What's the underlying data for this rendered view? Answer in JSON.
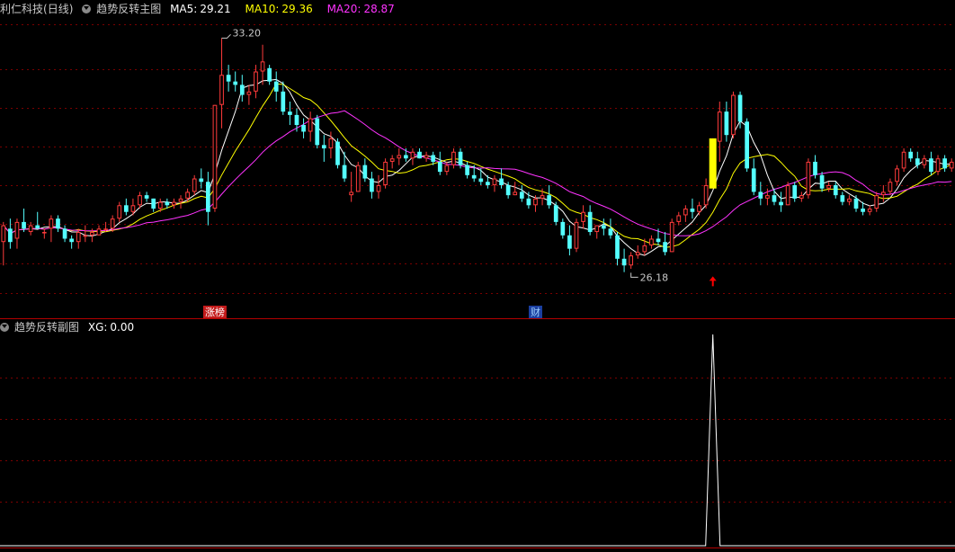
{
  "main_panel": {
    "stock_name": "利仁科技",
    "period": "(日线)",
    "indicator_name": "趋势反转主图",
    "ma5_label": "MA5:",
    "ma5_value": "29.21",
    "ma10_label": "MA10:",
    "ma10_value": "29.36",
    "ma20_label": "MA20:",
    "ma20_value": "28.87",
    "high_label": "33.20",
    "low_label": "26.18",
    "event_tag_1": "涨榜",
    "event_tag_2": "财"
  },
  "sub_panel": {
    "indicator_name": "趋势反转副图",
    "xg_label": "XG:",
    "xg_value": "0.00"
  },
  "colors": {
    "background": "#000000",
    "grid": "#7a0000",
    "up_candle": "#ff3b3b",
    "down_candle": "#54ffff",
    "ma5": "#ffffff",
    "ma10": "#ffff00",
    "ma20": "#ff33ff",
    "signal_bar": "#ffff00",
    "signal_arrow": "#ff0000",
    "xg_line": "#ffffff"
  },
  "chart_data": [
    {
      "type": "candlestick",
      "title": "趋势反转主图",
      "ylim": [
        25.6,
        33.8
      ],
      "candles": [
        [
          27.1,
          27.7,
          26.4,
          27.6
        ],
        [
          27.5,
          27.8,
          26.9,
          27.1
        ],
        [
          27.2,
          27.8,
          26.9,
          27.7
        ],
        [
          27.7,
          28.1,
          27.4,
          27.5
        ],
        [
          27.4,
          27.7,
          27.3,
          27.6
        ],
        [
          27.6,
          28.0,
          27.5,
          27.5
        ],
        [
          27.4,
          27.5,
          27.2,
          27.4
        ],
        [
          27.5,
          27.9,
          27.1,
          27.8
        ],
        [
          27.8,
          27.9,
          27.4,
          27.5
        ],
        [
          27.5,
          27.6,
          27.1,
          27.2
        ],
        [
          27.2,
          27.3,
          26.9,
          27.1
        ],
        [
          27.1,
          27.5,
          26.9,
          27.4
        ],
        [
          27.3,
          27.6,
          27.1,
          27.3
        ],
        [
          27.3,
          27.5,
          27.1,
          27.4
        ],
        [
          27.3,
          27.6,
          27.3,
          27.5
        ],
        [
          27.5,
          27.7,
          27.4,
          27.5
        ],
        [
          27.5,
          27.9,
          27.4,
          27.8
        ],
        [
          27.8,
          28.3,
          27.7,
          28.2
        ],
        [
          28.2,
          28.4,
          27.9,
          28.0
        ],
        [
          28.0,
          28.4,
          27.9,
          28.2
        ],
        [
          28.2,
          28.6,
          28.1,
          28.5
        ],
        [
          28.5,
          28.6,
          28.3,
          28.4
        ],
        [
          28.4,
          28.4,
          28.0,
          28.1
        ],
        [
          28.1,
          28.4,
          28.0,
          28.3
        ],
        [
          28.3,
          28.4,
          28.1,
          28.2
        ],
        [
          28.2,
          28.4,
          28.1,
          28.3
        ],
        [
          28.3,
          28.5,
          28.1,
          28.4
        ],
        [
          28.4,
          28.7,
          28.3,
          28.6
        ],
        [
          28.6,
          29.1,
          28.5,
          29.0
        ],
        [
          29.0,
          29.3,
          28.7,
          28.9
        ],
        [
          28.9,
          29.2,
          27.6,
          28.0
        ],
        [
          28.1,
          31.2,
          28.0,
          31.2
        ],
        [
          31.2,
          33.2,
          30.5,
          32.1
        ],
        [
          32.1,
          32.4,
          31.6,
          31.9
        ],
        [
          31.9,
          32.2,
          31.6,
          31.8
        ],
        [
          31.8,
          32.1,
          31.3,
          31.5
        ],
        [
          31.5,
          31.8,
          31.2,
          31.6
        ],
        [
          31.6,
          32.4,
          31.4,
          32.2
        ],
        [
          32.2,
          33.0,
          31.8,
          32.5
        ],
        [
          32.3,
          32.4,
          31.8,
          31.9
        ],
        [
          31.9,
          32.2,
          31.3,
          31.6
        ],
        [
          31.6,
          31.9,
          30.9,
          31.0
        ],
        [
          31.0,
          31.3,
          30.6,
          30.9
        ],
        [
          30.9,
          31.1,
          30.4,
          30.6
        ],
        [
          30.6,
          30.8,
          30.2,
          30.4
        ],
        [
          30.4,
          31.0,
          30.1,
          30.8
        ],
        [
          30.8,
          30.9,
          29.9,
          30.0
        ],
        [
          30.0,
          30.3,
          29.5,
          29.9
        ],
        [
          29.9,
          30.4,
          29.6,
          30.2
        ],
        [
          30.1,
          30.2,
          29.3,
          29.4
        ],
        [
          29.4,
          29.8,
          28.9,
          29.0
        ],
        [
          28.5,
          29.2,
          28.3,
          28.6
        ],
        [
          28.6,
          29.5,
          28.6,
          29.4
        ],
        [
          29.4,
          29.6,
          28.9,
          29.0
        ],
        [
          29.0,
          29.2,
          28.4,
          28.6
        ],
        [
          28.6,
          29.1,
          28.4,
          28.8
        ],
        [
          28.8,
          29.6,
          28.7,
          29.5
        ],
        [
          29.5,
          29.7,
          29.3,
          29.6
        ],
        [
          29.6,
          29.9,
          29.4,
          29.7
        ],
        [
          29.7,
          29.9,
          29.5,
          29.6
        ],
        [
          29.6,
          29.9,
          29.4,
          29.8
        ],
        [
          29.8,
          29.9,
          29.6,
          29.6
        ],
        [
          29.6,
          29.8,
          29.5,
          29.7
        ],
        [
          29.7,
          29.8,
          29.4,
          29.5
        ],
        [
          29.5,
          29.8,
          29.1,
          29.2
        ],
        [
          29.2,
          29.5,
          29.1,
          29.4
        ],
        [
          29.4,
          29.9,
          29.3,
          29.8
        ],
        [
          29.8,
          29.9,
          29.3,
          29.4
        ],
        [
          29.4,
          29.5,
          29.0,
          29.1
        ],
        [
          29.1,
          29.4,
          28.9,
          29.0
        ],
        [
          29.0,
          29.3,
          28.8,
          28.9
        ],
        [
          28.9,
          29.1,
          28.7,
          28.8
        ],
        [
          28.8,
          29.1,
          28.6,
          29.0
        ],
        [
          29.0,
          29.3,
          28.7,
          28.8
        ],
        [
          28.8,
          28.9,
          28.4,
          28.5
        ],
        [
          28.5,
          28.9,
          28.5,
          28.6
        ],
        [
          28.6,
          28.8,
          28.3,
          28.4
        ],
        [
          28.4,
          28.6,
          28.1,
          28.2
        ],
        [
          28.2,
          28.5,
          28.0,
          28.4
        ],
        [
          28.4,
          28.7,
          28.2,
          28.5
        ],
        [
          28.5,
          28.8,
          28.1,
          28.2
        ],
        [
          28.2,
          28.3,
          27.6,
          27.7
        ],
        [
          27.7,
          27.8,
          27.2,
          27.3
        ],
        [
          27.3,
          27.6,
          26.7,
          26.9
        ],
        [
          26.9,
          27.8,
          26.8,
          27.7
        ],
        [
          27.7,
          28.2,
          27.5,
          28.0
        ],
        [
          28.0,
          28.2,
          27.3,
          27.4
        ],
        [
          27.4,
          27.6,
          27.2,
          27.6
        ],
        [
          27.6,
          27.8,
          27.3,
          27.5
        ],
        [
          27.5,
          27.8,
          27.2,
          27.3
        ],
        [
          27.3,
          27.4,
          26.4,
          26.6
        ],
        [
          26.6,
          26.9,
          26.2,
          26.4
        ],
        [
          26.4,
          26.8,
          26.3,
          26.7
        ],
        [
          26.7,
          27.0,
          26.6,
          26.8
        ],
        [
          26.8,
          27.2,
          26.7,
          27.0
        ],
        [
          27.0,
          27.3,
          26.9,
          27.2
        ],
        [
          27.2,
          27.5,
          27.0,
          27.1
        ],
        [
          27.1,
          27.4,
          26.7,
          26.8
        ],
        [
          26.8,
          27.8,
          26.8,
          27.7
        ],
        [
          27.7,
          28.0,
          27.6,
          27.9
        ],
        [
          27.9,
          28.2,
          27.7,
          28.1
        ],
        [
          28.1,
          28.4,
          27.8,
          28.0
        ],
        [
          28.0,
          28.3,
          27.9,
          28.2
        ],
        [
          28.2,
          29.0,
          28.1,
          28.8
        ],
        [
          28.8,
          30.2,
          28.7,
          30.1
        ],
        [
          30.1,
          31.3,
          29.5,
          31.0
        ],
        [
          31.0,
          31.3,
          30.1,
          30.3
        ],
        [
          30.3,
          31.6,
          30.2,
          31.5
        ],
        [
          31.5,
          31.6,
          30.5,
          30.7
        ],
        [
          30.7,
          30.8,
          29.2,
          29.3
        ],
        [
          29.3,
          29.6,
          28.5,
          28.6
        ],
        [
          28.6,
          28.9,
          28.2,
          28.4
        ],
        [
          28.4,
          28.7,
          28.2,
          28.5
        ],
        [
          28.5,
          28.7,
          28.2,
          28.3
        ],
        [
          28.3,
          28.6,
          28.0,
          28.2
        ],
        [
          28.2,
          28.9,
          28.2,
          28.8
        ],
        [
          28.8,
          28.9,
          28.3,
          28.4
        ],
        [
          28.4,
          28.6,
          28.3,
          28.5
        ],
        [
          28.5,
          29.6,
          28.4,
          29.5
        ],
        [
          29.5,
          29.7,
          29.0,
          29.1
        ],
        [
          29.1,
          29.2,
          28.6,
          28.7
        ],
        [
          28.7,
          28.9,
          28.6,
          28.8
        ],
        [
          28.8,
          28.9,
          28.4,
          28.5
        ],
        [
          28.5,
          28.6,
          28.2,
          28.3
        ],
        [
          28.3,
          28.5,
          28.2,
          28.4
        ],
        [
          28.4,
          28.5,
          28.0,
          28.1
        ],
        [
          28.1,
          28.3,
          27.9,
          28.0
        ],
        [
          28.0,
          28.2,
          27.9,
          28.1
        ],
        [
          28.1,
          28.6,
          28.0,
          28.5
        ],
        [
          28.5,
          28.8,
          28.3,
          28.6
        ],
        [
          28.6,
          29.0,
          28.5,
          28.9
        ],
        [
          28.9,
          29.4,
          28.8,
          29.3
        ],
        [
          29.3,
          29.9,
          29.2,
          29.8
        ],
        [
          29.8,
          29.9,
          29.5,
          29.6
        ],
        [
          29.6,
          29.8,
          29.3,
          29.4
        ],
        [
          29.4,
          29.7,
          29.3,
          29.6
        ],
        [
          29.6,
          29.8,
          29.1,
          29.2
        ],
        [
          29.2,
          29.7,
          29.1,
          29.6
        ],
        [
          29.6,
          29.7,
          29.2,
          29.3
        ],
        [
          29.3,
          29.6,
          29.2,
          29.5
        ]
      ],
      "signal_index": 104,
      "signal_price": 27.6,
      "high_point": {
        "index": 32,
        "price": 33.2
      },
      "low_point": {
        "index": 92,
        "price": 26.18
      },
      "series": [
        {
          "name": "MA5",
          "last": 29.21
        },
        {
          "name": "MA10",
          "last": 29.36
        },
        {
          "name": "MA20",
          "last": 28.87
        }
      ],
      "event_markers": [
        {
          "index": 31,
          "text": "涨榜"
        },
        {
          "index": 78,
          "text": "财"
        }
      ]
    },
    {
      "type": "line",
      "title": "趋势反转副图",
      "series": [
        {
          "name": "XG",
          "spike_index": 104,
          "spike_value": 1,
          "base_value": 0,
          "last": 0.0
        }
      ],
      "ylim": [
        0,
        1
      ]
    }
  ]
}
